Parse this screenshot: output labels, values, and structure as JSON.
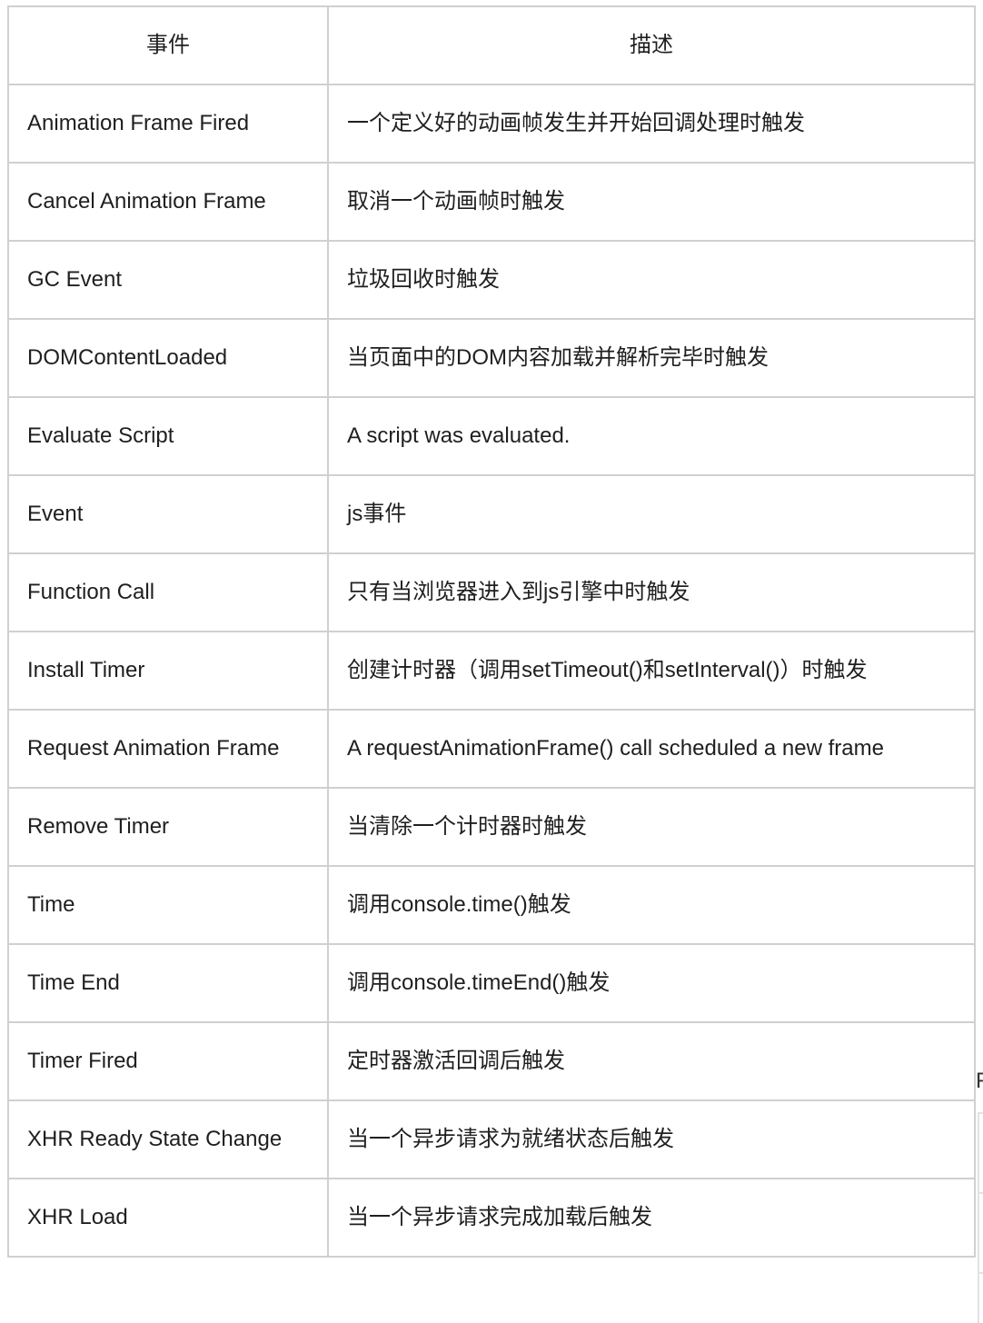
{
  "table": {
    "headers": [
      "事件",
      "描述"
    ],
    "rows": [
      [
        "Animation Frame Fired",
        "一个定义好的动画帧发生并开始回调处理时触发"
      ],
      [
        "Cancel Animation Frame",
        "取消一个动画帧时触发"
      ],
      [
        "GC Event",
        "垃圾回收时触发"
      ],
      [
        "DOMContentLoaded",
        "当页面中的DOM内容加载并解析完毕时触发"
      ],
      [
        "Evaluate Script",
        "A script was evaluated."
      ],
      [
        "Event",
        "js事件"
      ],
      [
        "Function Call",
        "只有当浏览器进入到js引擎中时触发"
      ],
      [
        "Install Timer",
        "创建计时器（调用setTimeout()和setInterval()）时触发"
      ],
      [
        "Request Animation Frame",
        "A requestAnimationFrame() call scheduled a new frame"
      ],
      [
        "Remove Timer",
        "当清除一个计时器时触发"
      ],
      [
        "Time",
        "调用console.time()触发"
      ],
      [
        "Time End",
        "调用console.timeEnd()触发"
      ],
      [
        "Timer Fired",
        "定时器激活回调后触发"
      ],
      [
        "XHR Ready State Change",
        "当一个异步请求为就绪状态后触发"
      ],
      [
        "XHR Load",
        "当一个异步请求完成加载后触发"
      ]
    ]
  },
  "edge_fragment": {
    "glyph": "F"
  }
}
